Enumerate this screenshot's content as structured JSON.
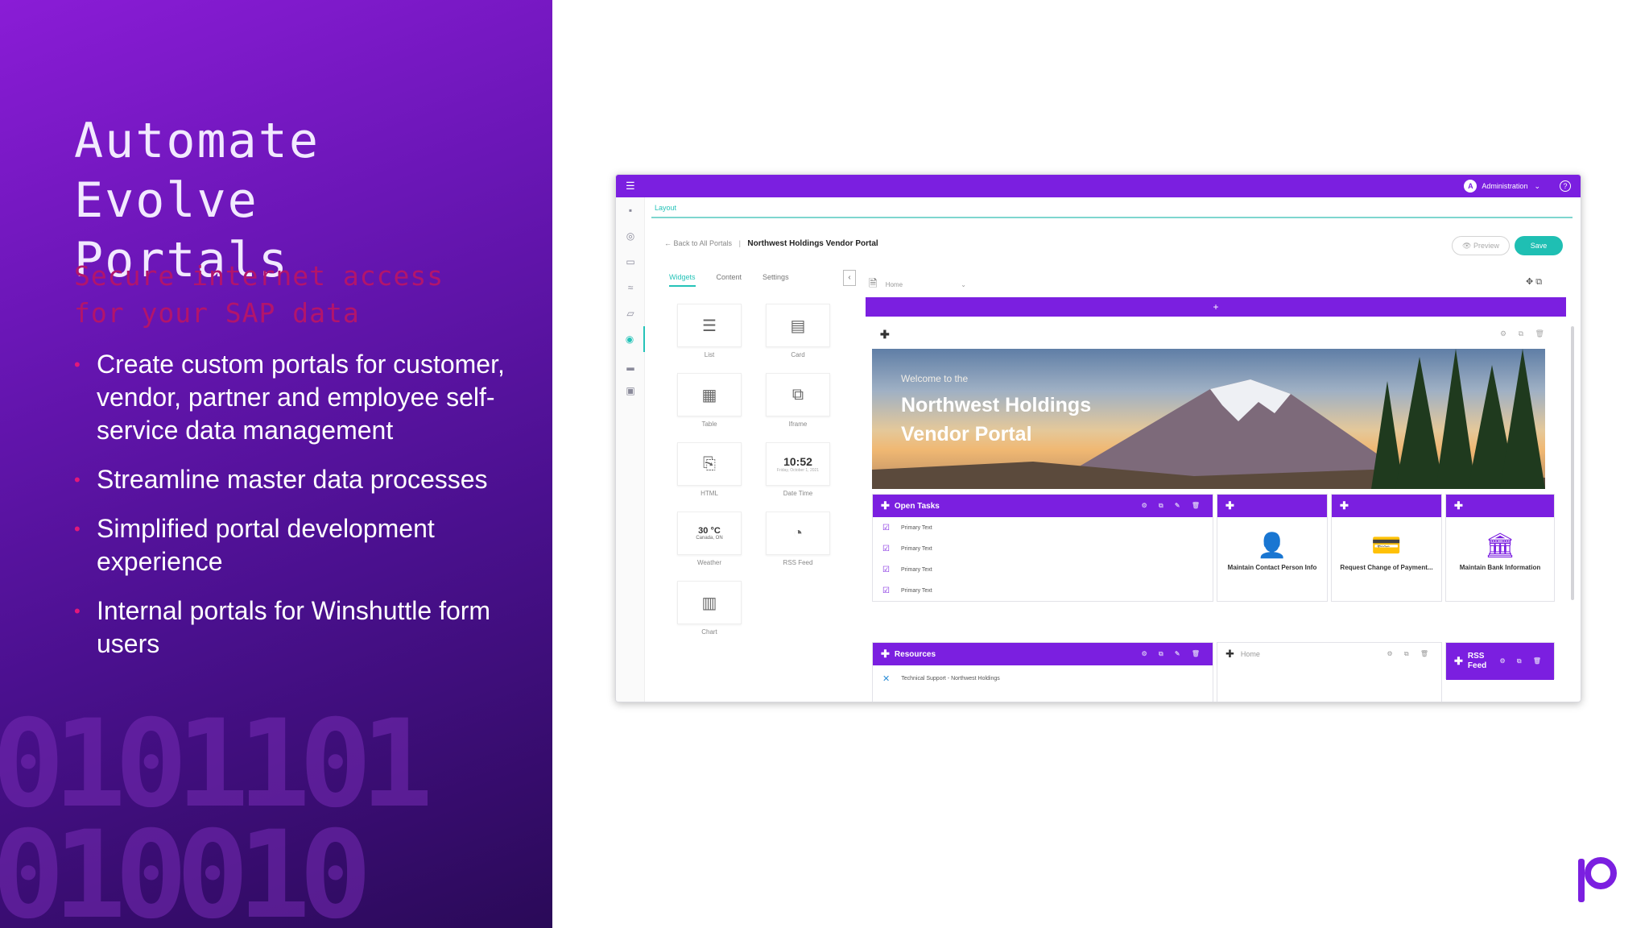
{
  "slide": {
    "title_lines": [
      "Automate",
      "Evolve",
      "Portals"
    ],
    "subtitle_lines": [
      "Secure internet access",
      "for your SAP data"
    ],
    "bullets": [
      "Create custom portals for customer, vendor, partner and employee self-service data management",
      "Streamline master data processes",
      "Simplified portal development experience",
      "Internal portals for Winshuttle form users"
    ],
    "binary_art_lines": [
      "0101101",
      "010010"
    ],
    "colors": {
      "panel_purple": "#6a16b6",
      "bullet_pink": "#e2187a",
      "subtitle_magenta": "#b2156c",
      "logo_purple": "#7b1fe0"
    },
    "logo_icon": "brand-p-logo"
  },
  "app": {
    "topbar": {
      "avatar_initial": "A",
      "user_label": "Administration",
      "chevron": "⌄",
      "help": "?"
    },
    "rail_icons": [
      "dashboard-icon",
      "globe-icon",
      "chat-icon",
      "flow-icon",
      "comment-icon",
      "portal-icon",
      "chart-icon",
      "calendar-icon"
    ],
    "layout_tab": "Layout",
    "breadcrumb": {
      "back": "← Back to All Portals",
      "separator": "|",
      "current": "Northwest Holdings Vendor Portal"
    },
    "preview_label": "👁 Preview",
    "save_label": "Save",
    "panel_tabs": [
      "Widgets",
      "Content",
      "Settings"
    ],
    "collapse_glyph": "‹",
    "widgets": [
      {
        "label": "List",
        "icon": "☰"
      },
      {
        "label": "Card",
        "icon": "▤"
      },
      {
        "label": "Table",
        "icon": "▦"
      },
      {
        "label": "Iframe",
        "icon": "⧉"
      },
      {
        "label": "HTML",
        "icon": "⎘"
      },
      {
        "label": "Date Time",
        "icon": ""
      },
      {
        "label": "Weather",
        "icon": ""
      },
      {
        "label": "RSS Feed",
        "icon": "◔"
      },
      {
        "label": "Chart",
        "icon": "▥"
      }
    ],
    "clock": {
      "time": "10:52",
      "date": "Friday, October 1, 2021"
    },
    "weather": {
      "temp": "30 °C",
      "location": "Canada, ON"
    },
    "page_selector": {
      "doc_icon": "🗎",
      "label": "Home",
      "chevron": "⌄"
    },
    "canvas_tools": "✥ ⧉",
    "add_row_glyph": "+",
    "row_plus": "✚",
    "row_tools": "⚙ ⧉ 🗑",
    "hero": {
      "small": "Welcome to the",
      "title": "Northwest Holdings Vendor Portal"
    },
    "open_tasks": {
      "title": "Open Tasks",
      "tools": "⚙ ⧉ ✎ 🗑",
      "items": [
        "Primary Text",
        "Primary Text",
        "Primary Text",
        "Primary Text"
      ]
    },
    "quick_links": [
      {
        "label": "Maintain Contact Person Info",
        "icon": "👤"
      },
      {
        "label": "Request Change of Payment...",
        "icon": "💳"
      },
      {
        "label": "Maintain Bank Information",
        "icon": "🏛"
      }
    ],
    "resources": {
      "title": "Resources",
      "tools": "⚙ ⧉ ✎ 🗑",
      "item": "Technical Support - Northwest Holdings"
    },
    "home_card": {
      "label": "Home",
      "tools": "⚙ ⧉ 🗑"
    },
    "rss_card": {
      "title": "RSS Feed",
      "tools": "⚙ ⧉ 🗑"
    },
    "card_plus": "✚"
  }
}
